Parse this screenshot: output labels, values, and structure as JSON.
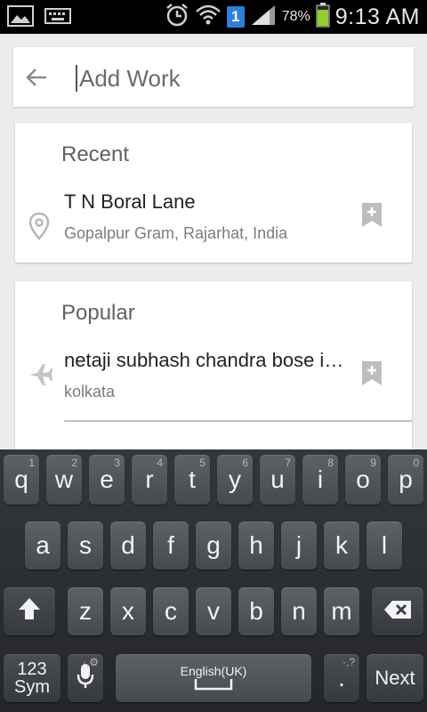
{
  "status_bar": {
    "time": "9:13 AM",
    "battery_percent": "78%",
    "sim_slot": "1",
    "icons": [
      "gallery-icon",
      "keyboard-icon",
      "alarm-icon",
      "wifi-icon",
      "sim-icon",
      "signal-icon",
      "battery-icon"
    ]
  },
  "search": {
    "placeholder": "Add Work",
    "value": "",
    "back_icon": "back-arrow-icon"
  },
  "recent": {
    "title": "Recent",
    "items": [
      {
        "title": "T N Boral Lane",
        "subtitle": "Gopalpur Gram, Rajarhat, India",
        "icon": "location-pin-icon",
        "action_icon": "bookmark-add-icon"
      }
    ]
  },
  "popular": {
    "title": "Popular",
    "items": [
      {
        "title": "netaji subhash chandra bose international airport",
        "subtitle": "kolkata",
        "icon": "airplane-icon",
        "action_icon": "bookmark-add-icon"
      }
    ]
  },
  "keyboard": {
    "row1": [
      {
        "k": "q",
        "h": "1"
      },
      {
        "k": "w",
        "h": "2"
      },
      {
        "k": "e",
        "h": "3"
      },
      {
        "k": "r",
        "h": "4"
      },
      {
        "k": "t",
        "h": "5"
      },
      {
        "k": "y",
        "h": "6"
      },
      {
        "k": "u",
        "h": "7"
      },
      {
        "k": "i",
        "h": "8"
      },
      {
        "k": "o",
        "h": "9"
      },
      {
        "k": "p",
        "h": "0"
      }
    ],
    "row2": [
      "a",
      "s",
      "d",
      "f",
      "g",
      "h",
      "j",
      "k",
      "l"
    ],
    "row3": [
      "z",
      "x",
      "c",
      "v",
      "b",
      "n",
      "m"
    ],
    "sym_label_top": "123",
    "sym_label_bottom": "Sym",
    "space_label": "English(UK)",
    "period_label": ".",
    "period_hint": "·,?",
    "next_label": "Next",
    "mic_hint": "·,⚙"
  },
  "colors": {
    "accent_sim": "#2f7fd8",
    "battery": "#8fd12a"
  }
}
